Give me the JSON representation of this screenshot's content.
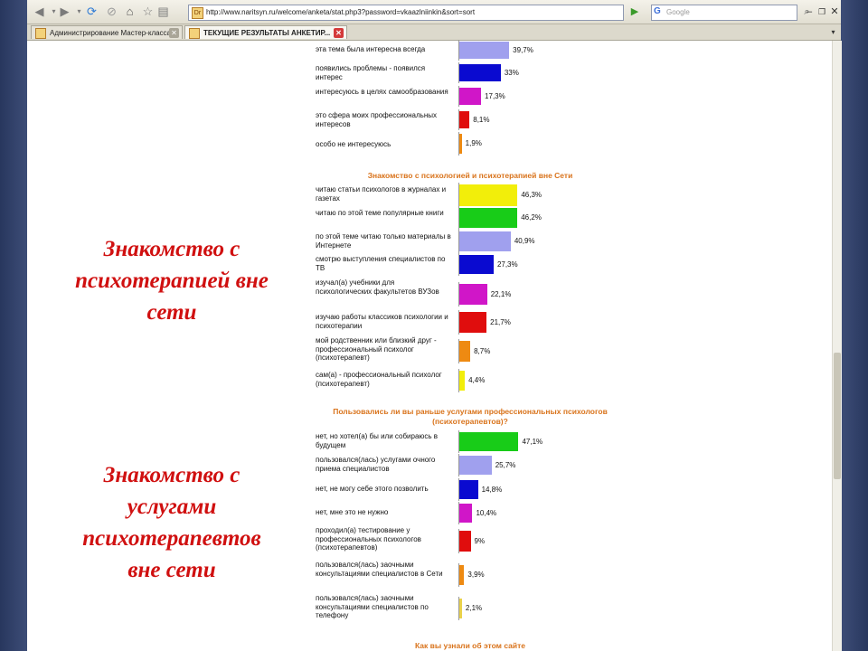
{
  "browser": {
    "url": "http://www.naritsyn.ru/welcome/anketa/stat.php3?password=vkaazlniinkin&sort=sort",
    "search_placeholder": "Google",
    "tabs": [
      {
        "label": "Администрирование Мастер-класса ...",
        "active": false
      },
      {
        "label": "ТЕКУЩИЕ РЕЗУЛЬТАТЫ АНКЕТИР...",
        "active": true
      }
    ]
  },
  "captions": {
    "first": [
      "Знакомство с",
      "психотерапией вне",
      "сети"
    ],
    "second": [
      "Знакомство с",
      "услугами",
      "психотерапевтов",
      "вне сети"
    ]
  },
  "colors": {
    "lavender": "#a0a0ee",
    "blue": "#0a0ad0",
    "magenta": "#d016c8",
    "red": "#e00d0d",
    "orange": "#ee8a12",
    "yellow": "#f2ee0a",
    "green": "#18cc18",
    "gold": "#ead24a",
    "title_orange": "#d9731b",
    "caption_red": "#d01010"
  },
  "chart_data": [
    {
      "type": "bar",
      "title": "",
      "categories": [
        "эта тема была интересна всегда",
        "появились проблемы - появился интерес",
        "интересуюсь в целях самообразования",
        "это сфера моих профессиональных интересов",
        "особо не интересуюсь"
      ],
      "values": [
        39.7,
        33,
        17.3,
        8.1,
        1.9
      ],
      "value_labels": [
        "39,7%",
        "33%",
        "17,3%",
        "8,1%",
        "1,9%"
      ],
      "colors": [
        "lavender",
        "blue",
        "magenta",
        "red",
        "orange"
      ]
    },
    {
      "type": "bar",
      "title": "Знакомство с психологией и психотерапией вне Сети",
      "categories": [
        "читаю статьи психологов в журналах и газетах",
        "читаю по этой теме популярные книги",
        "по этой теме читаю только материалы в Интернете",
        "смотрю выступления специалистов по ТВ",
        "изучал(а) учебники для психологических факультетов ВУЗов",
        "изучаю работы классиков психологии и психотерапии",
        "мой родственник или близкий друг - профессиональный психолог (психотерапевт)",
        "сам(а) - профессиональный психолог (психотерапевт)"
      ],
      "values": [
        46.3,
        46.2,
        40.9,
        27.3,
        22.1,
        21.7,
        8.7,
        4.4
      ],
      "value_labels": [
        "46,3%",
        "46,2%",
        "40,9%",
        "27,3%",
        "22,1%",
        "21,7%",
        "8,7%",
        "4,4%"
      ],
      "colors": [
        "yellow",
        "green",
        "lavender",
        "blue",
        "magenta",
        "red",
        "orange",
        "yellow"
      ]
    },
    {
      "type": "bar",
      "title": "Пользовались ли вы раньше услугами профессиональных психологов (психотерапевтов)?",
      "categories": [
        "нет, но хотел(а) бы или собираюсь в будущем",
        "пользовался(лась) услугами очного приема специалистов",
        "нет, не могу себе этого позволить",
        "нет, мне это не нужно",
        "проходил(а) тестирование у профессиональных психологов (психотерапевтов)",
        "пользовался(лась) заочными консультациями специалистов в Сети",
        "пользовался(лась) заочными консультациями специалистов по телефону"
      ],
      "values": [
        47.1,
        25.7,
        14.8,
        10.4,
        9,
        3.9,
        2.1
      ],
      "value_labels": [
        "47,1%",
        "25,7%",
        "14,8%",
        "10,4%",
        "9%",
        "3,9%",
        "2,1%"
      ],
      "colors": [
        "green",
        "lavender",
        "blue",
        "magenta",
        "red",
        "orange",
        "gold"
      ]
    },
    {
      "type": "bar",
      "title": "Как вы узнали об этом сайте",
      "categories": [],
      "values": []
    }
  ]
}
